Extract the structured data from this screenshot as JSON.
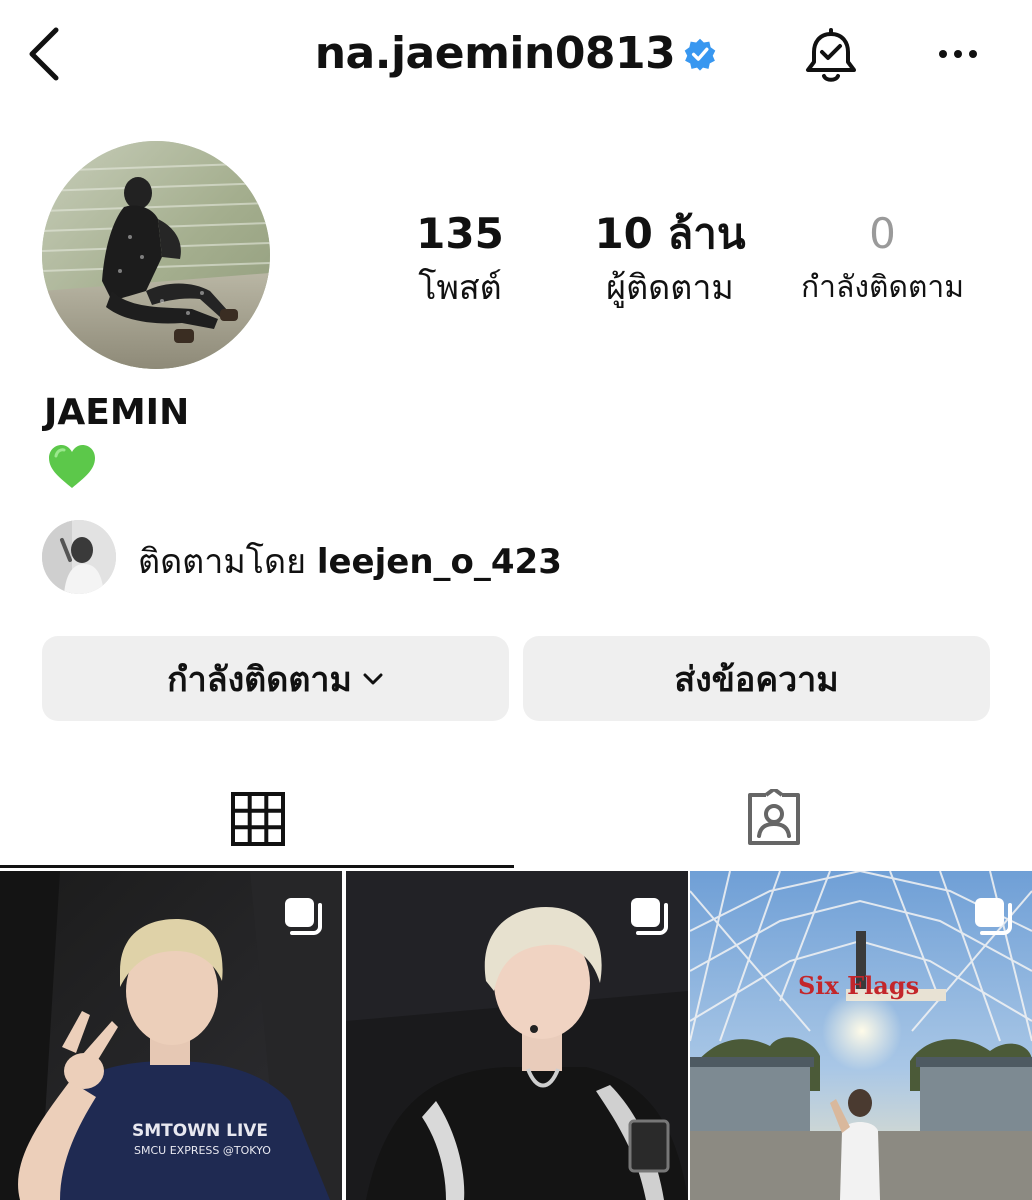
{
  "header": {
    "username": "na.jaemin0813",
    "verified": true,
    "icons": [
      "back-icon",
      "verified-badge-icon",
      "notification-bell-icon",
      "more-options-icon"
    ]
  },
  "stats": {
    "posts": {
      "value": "135",
      "label": "โพสต์"
    },
    "followers": {
      "value": "10 ล้าน",
      "label": "ผู้ติดตาม"
    },
    "following": {
      "value": "0",
      "label": "กำลังติดตาม"
    }
  },
  "profile": {
    "name": "JAEMIN",
    "bio_emoji": "💚"
  },
  "mutual": {
    "prefix": "ติดตามโดย",
    "username": "leejen_o_423"
  },
  "actions": {
    "following_label": "กำลังติดตาม",
    "message_label": "ส่งข้อความ"
  },
  "tabs": [
    {
      "name": "grid",
      "icon": "grid-icon",
      "active": true
    },
    {
      "name": "tagged",
      "icon": "tagged-icon",
      "active": false
    }
  ],
  "posts": [
    {
      "type": "carousel",
      "shirt_line1": "SMTOWN LIVE",
      "shirt_line2": "SMCU EXPRESS @TOKYO"
    },
    {
      "type": "carousel"
    },
    {
      "type": "carousel",
      "sign_text": "Six Flags"
    }
  ],
  "colors": {
    "verified_blue": "#3897f0",
    "button_bg": "#efefef",
    "muted_gray": "#9a9a9a",
    "heart_green": "#5cc84a"
  }
}
